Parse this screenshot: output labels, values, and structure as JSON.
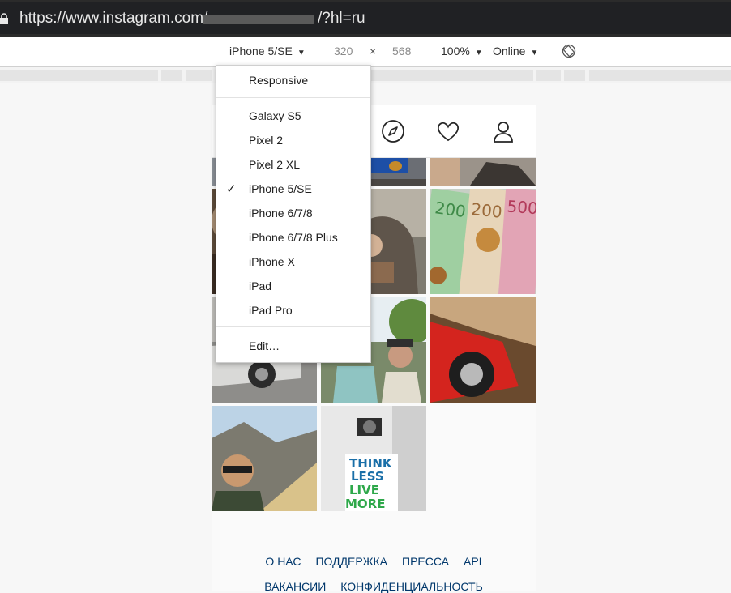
{
  "browser": {
    "url_prefix": "https://www.instagram.com/",
    "url_suffix": "/?hl=ru"
  },
  "device_toolbar": {
    "device": "iPhone 5/SE",
    "width": "320",
    "times": "×",
    "height": "568",
    "zoom": "100%",
    "network": "Online"
  },
  "device_menu": {
    "responsive": "Responsive",
    "devices": [
      "Galaxy S5",
      "Pixel 2",
      "Pixel 2 XL",
      "iPhone 5/SE",
      "iPhone 6/7/8",
      "iPhone 6/7/8 Plus",
      "iPhone X",
      "iPad",
      "iPad Pro"
    ],
    "selected_index": 3,
    "edit": "Edit…",
    "check_glyph": "✓"
  },
  "instagram": {
    "nav_icons": [
      "explore-compass-icon",
      "activity-heart-icon",
      "profile-person-icon"
    ],
    "footer_row1": [
      "О НАС",
      "ПОДДЕРЖКА",
      "ПРЕССА",
      "API"
    ],
    "footer_row2": [
      "ВАКАНСИИ",
      "КОНФИДЕНЦИАЛЬНОСТЬ"
    ]
  },
  "photo_overlays": {
    "banknote_values": [
      "200",
      "200",
      "500"
    ],
    "shirt_text": [
      "THINK",
      "LESS",
      "LIVE",
      "MORE"
    ]
  }
}
